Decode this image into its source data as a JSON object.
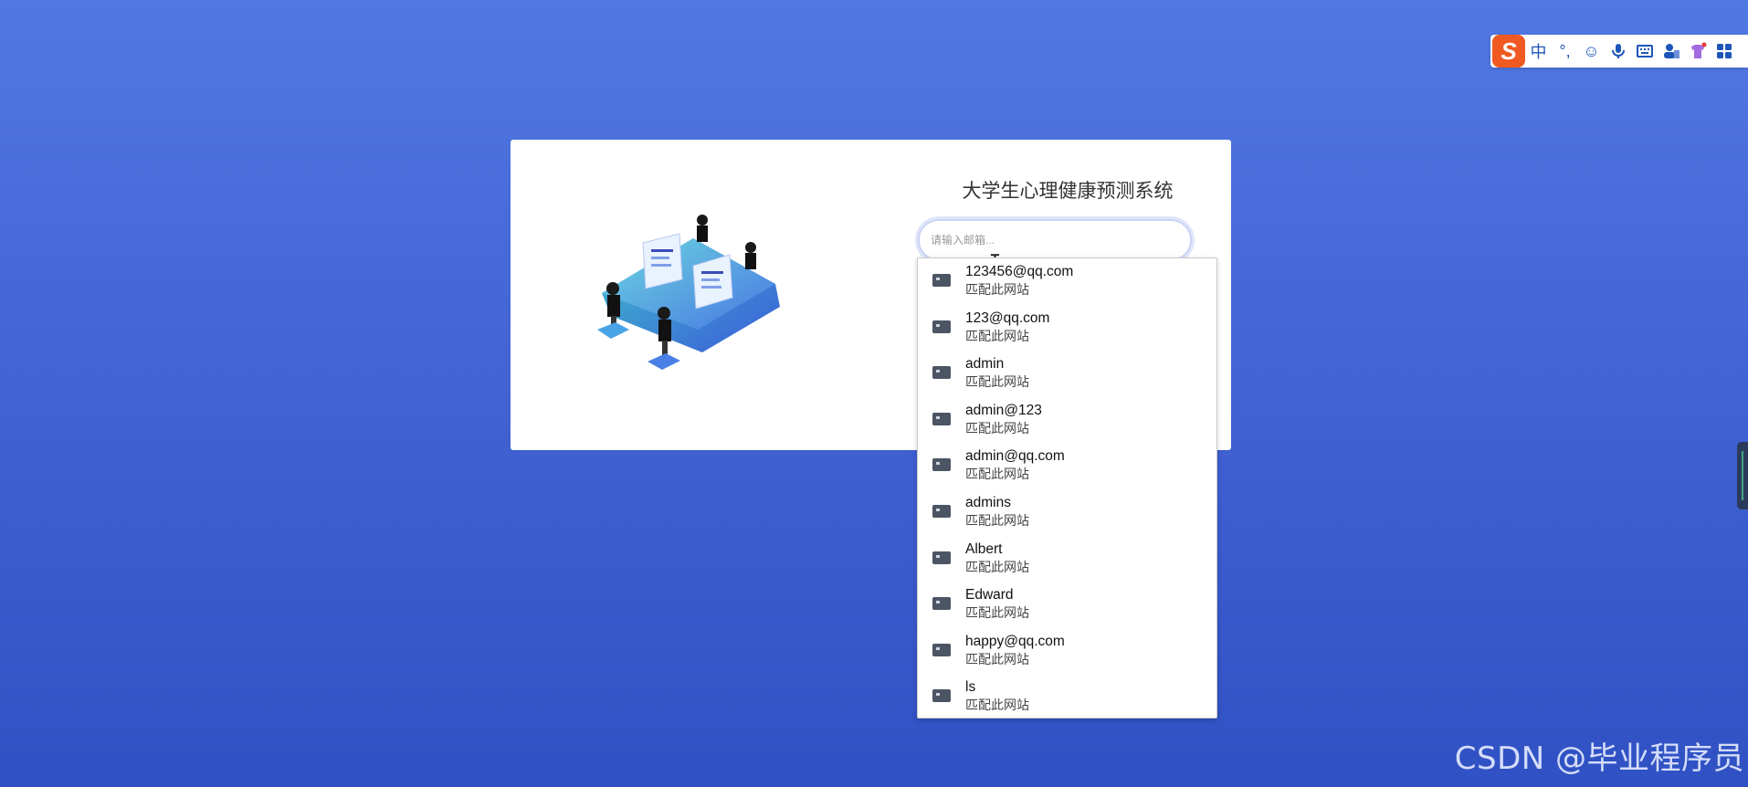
{
  "ime_toolbar": {
    "logo_text": "S",
    "items": [
      {
        "name": "chinese-mode-icon",
        "glyph": "中"
      },
      {
        "name": "punctuation-icon",
        "glyph": "°,"
      },
      {
        "name": "emoji-icon",
        "glyph": "☺"
      },
      {
        "name": "microphone-icon",
        "glyph": ""
      },
      {
        "name": "keyboard-icon",
        "glyph": ""
      },
      {
        "name": "user-icon",
        "glyph": ""
      },
      {
        "name": "skin-icon",
        "glyph": ""
      },
      {
        "name": "grid-menu-icon",
        "glyph": ""
      }
    ],
    "accent_color": "#f05a22",
    "icon_color": "#1e56b8"
  },
  "login": {
    "title": "大学生心理健康预测系统",
    "email_placeholder": "请输入邮箱..."
  },
  "autocomplete": {
    "items": [
      {
        "value": "123456@qq.com",
        "hint": "匹配此网站"
      },
      {
        "value": "123@qq.com",
        "hint": "匹配此网站"
      },
      {
        "value": "admin",
        "hint": "匹配此网站"
      },
      {
        "value": "admin@123",
        "hint": "匹配此网站"
      },
      {
        "value": "admin@qq.com",
        "hint": "匹配此网站"
      },
      {
        "value": "admins",
        "hint": "匹配此网站"
      },
      {
        "value": "Albert",
        "hint": "匹配此网站"
      },
      {
        "value": "Edward",
        "hint": "匹配此网站"
      },
      {
        "value": "happy@qq.com",
        "hint": "匹配此网站"
      },
      {
        "value": "ls",
        "hint": "匹配此网站"
      }
    ]
  },
  "watermark": "CSDN @毕业程序员",
  "colors": {
    "background_top": "#5179e2",
    "background_bottom": "#2f51c3",
    "card": "#ffffff"
  }
}
